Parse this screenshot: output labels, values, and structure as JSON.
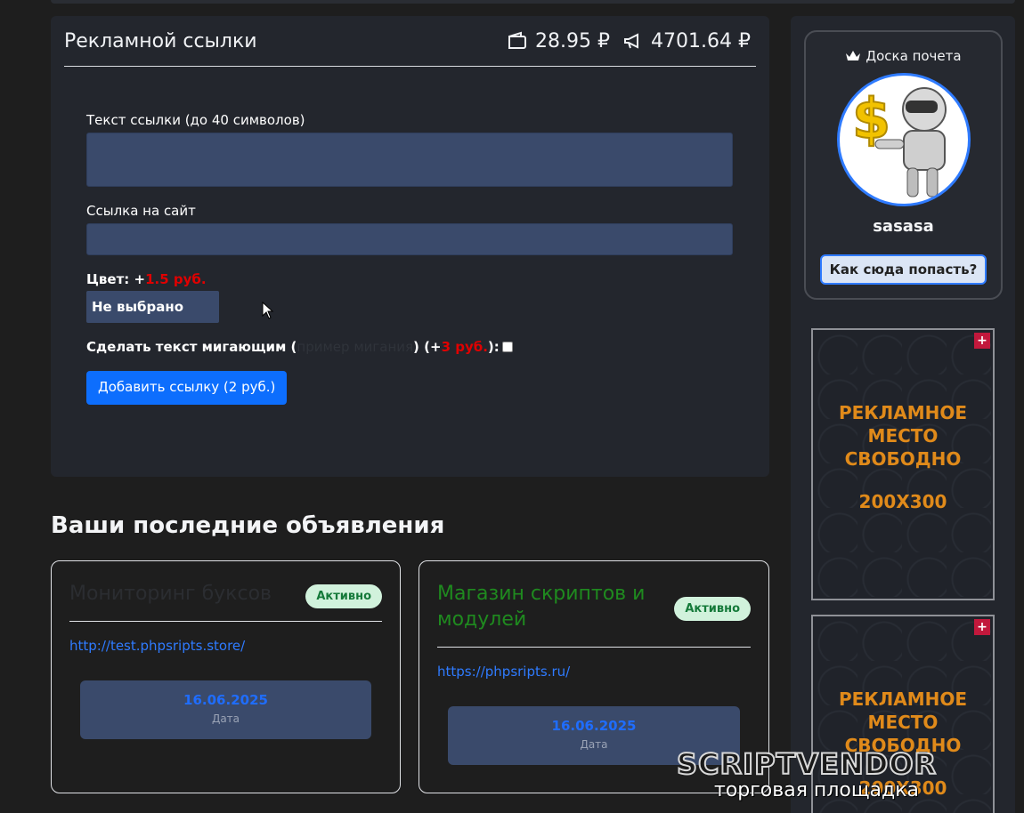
{
  "main_card": {
    "title": "Рекламной ссылки",
    "balance_1": "28.95 ₽",
    "balance_2": "4701.64 ₽"
  },
  "form": {
    "text_label": "Текст ссылки (до 40 символов)",
    "site_label": "Ссылка на сайт",
    "color_label": "Цвет: +",
    "color_price": "1.5 руб.",
    "color_select_value": "Не выбрано",
    "blink_label": "Сделать текст мигающим (",
    "blink_demo": "пример мигания",
    "blink_mid": ") (+",
    "blink_price": "3 руб.",
    "blink_end": "):",
    "submit_label": "Добавить ссылку (2 руб.)"
  },
  "ads_section": {
    "title": "Ваши последние объявления",
    "items": [
      {
        "title": "Мониторинг буксов",
        "status": "Активно",
        "url": "http://test.phpsripts.store/",
        "date": "16.06.2025",
        "date_label": "Дата"
      },
      {
        "title": "Магазин скриптов и модулей",
        "status": "Активно",
        "url": "https://phpsripts.ru/",
        "date": "16.06.2025",
        "date_label": "Дата"
      }
    ]
  },
  "sidebar": {
    "honor_title": "Доска почета",
    "honor_name": "sasasa",
    "honor_button": "Как сюда попасть?",
    "slots": [
      {
        "plus": "+",
        "line1": "РЕКЛАМНОЕ",
        "line2": "МЕСТО",
        "line3": "СВОБОДНО",
        "size": "200X300"
      },
      {
        "plus": "+",
        "line1": "РЕКЛАМНОЕ",
        "line2": "МЕСТО",
        "line3": "СВОБОДНО",
        "size": "200X300"
      }
    ]
  },
  "watermark": {
    "brand": "SCRIPTVENDOR",
    "tagline": "торговая площадка"
  },
  "colors": {
    "accent": "#0d6efd",
    "price_red": "#e00000",
    "badge_green": "#157a3a",
    "ad_orange": "#e08a1a"
  }
}
